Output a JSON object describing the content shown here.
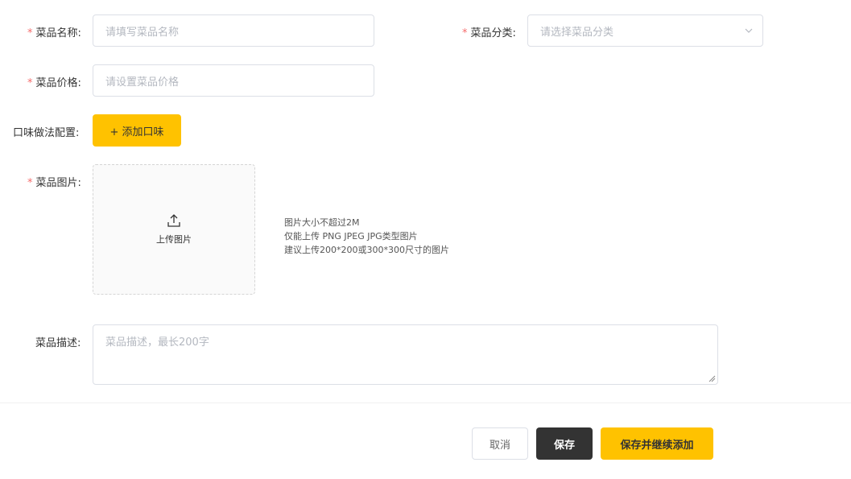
{
  "form": {
    "name": {
      "label": "菜品名称:",
      "required_mark": "*",
      "placeholder": "请填写菜品名称"
    },
    "category": {
      "label": "菜品分类:",
      "required_mark": "*",
      "placeholder": "请选择菜品分类"
    },
    "price": {
      "label": "菜品价格:",
      "required_mark": "*",
      "placeholder": "请设置菜品价格"
    },
    "flavor": {
      "label": "口味做法配置:",
      "add_button": "+ 添加口味"
    },
    "image": {
      "label": "菜品图片:",
      "required_mark": "*",
      "upload_text": "上传图片",
      "hints": [
        "图片大小不超过2M",
        "仅能上传 PNG JPEG JPG类型图片",
        "建议上传200*200或300*300尺寸的图片"
      ]
    },
    "description": {
      "label": "菜品描述:",
      "placeholder": "菜品描述，最长200字"
    }
  },
  "actions": {
    "cancel": "取消",
    "save": "保存",
    "save_continue": "保存并继续添加"
  },
  "colors": {
    "accent": "#ffc200",
    "dark": "#333333",
    "required": "#f56c6c",
    "border": "#dcdfe6"
  },
  "icons": {
    "upload": "upload-icon",
    "dropdown": "chevron-down-icon",
    "resize": "resize-handle-icon"
  }
}
